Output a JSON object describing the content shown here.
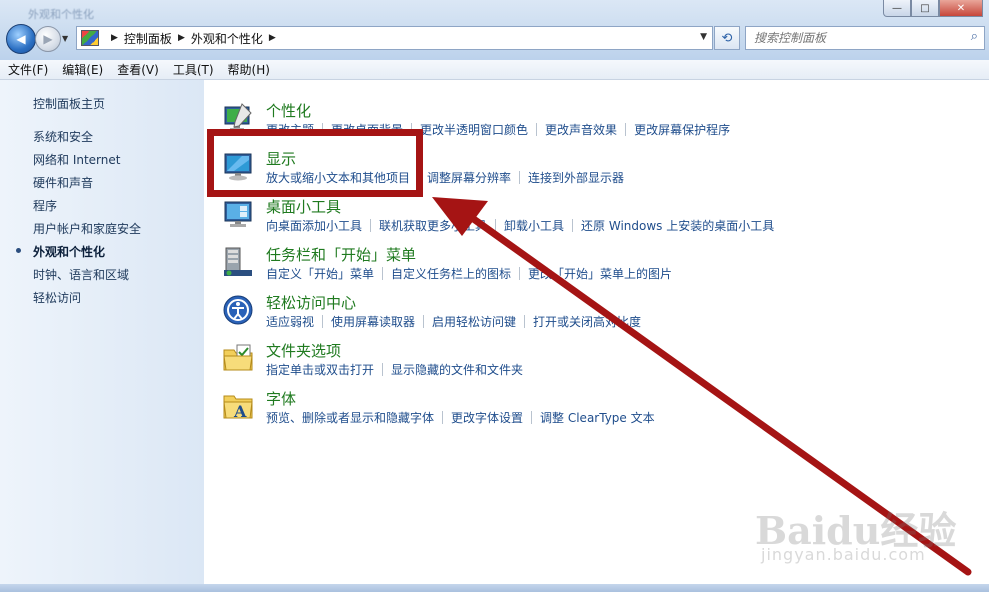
{
  "window": {
    "title": "外观和个性化",
    "controls": [
      "—",
      "□",
      "✕"
    ]
  },
  "nav": {
    "back_glyph": "◀",
    "forward_glyph": "▶",
    "breadcrumb": [
      "控制面板",
      "外观和个性化"
    ],
    "search_placeholder": "搜索控制面板"
  },
  "menubar": [
    "文件(F)",
    "编辑(E)",
    "查看(V)",
    "工具(T)",
    "帮助(H)"
  ],
  "sidebar": {
    "home": "控制面板主页",
    "items": [
      {
        "label": "系统和安全"
      },
      {
        "label": "网络和 Internet"
      },
      {
        "label": "硬件和声音"
      },
      {
        "label": "程序"
      },
      {
        "label": "用户帐户和家庭安全"
      },
      {
        "label": "外观和个性化",
        "active": true
      },
      {
        "label": "时钟、语言和区域"
      },
      {
        "label": "轻松访问"
      }
    ]
  },
  "categories": [
    {
      "title": "个性化",
      "icon": "personalization-icon",
      "links": [
        "更改主题",
        "更改桌面背景",
        "更改半透明窗口颜色",
        "更改声音效果",
        "更改屏幕保护程序"
      ]
    },
    {
      "title": "显示",
      "icon": "display-icon",
      "links": [
        "放大或缩小文本和其他项目",
        "调整屏幕分辨率",
        "连接到外部显示器"
      ]
    },
    {
      "title": "桌面小工具",
      "icon": "gadgets-icon",
      "links": [
        "向桌面添加小工具",
        "联机获取更多小工具",
        "卸载小工具",
        "还原 Windows 上安装的桌面小工具"
      ]
    },
    {
      "title": "任务栏和「开始」菜单",
      "icon": "taskbar-icon",
      "links": [
        "自定义「开始」菜单",
        "自定义任务栏上的图标",
        "更改「开始」菜单上的图片"
      ]
    },
    {
      "title": "轻松访问中心",
      "icon": "ease-of-access-icon",
      "links": [
        "适应弱视",
        "使用屏幕读取器",
        "启用轻松访问键",
        "打开或关闭高对比度"
      ]
    },
    {
      "title": "文件夹选项",
      "icon": "folder-options-icon",
      "links": [
        "指定单击或双击打开",
        "显示隐藏的文件和文件夹"
      ]
    },
    {
      "title": "字体",
      "icon": "fonts-icon",
      "links": [
        "预览、删除或者显示和隐藏字体",
        "更改字体设置",
        "调整 ClearType 文本"
      ]
    }
  ],
  "watermark": {
    "logo": "Baidu经验",
    "sub": "jingyan.baidu.com"
  },
  "colors": {
    "annotation": "#a51414",
    "category_title": "#1f7a1f",
    "link": "#1f4d8c"
  }
}
